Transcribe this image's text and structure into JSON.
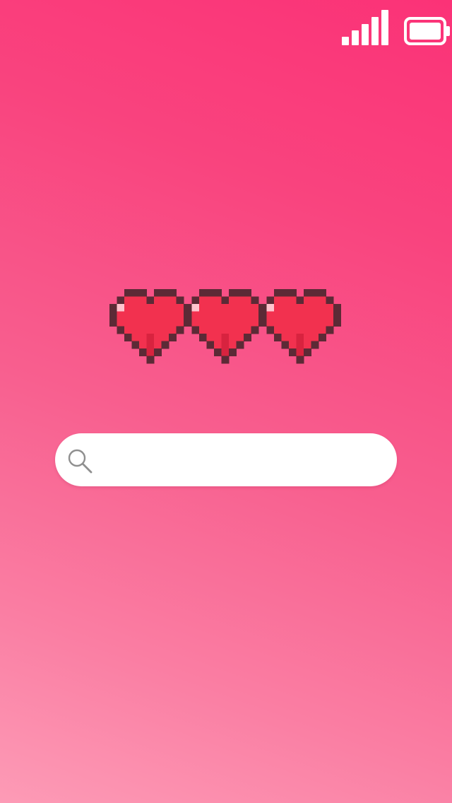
{
  "status_bar": {
    "signal_icon": "signal-strength-icon",
    "signal_bars": 5,
    "battery_icon": "battery-icon",
    "battery_level": 1.0
  },
  "hearts": {
    "icon": "pixel-heart-icon",
    "count": 3,
    "filled": 3
  },
  "search": {
    "icon": "search-icon",
    "value": "",
    "placeholder": ""
  },
  "colors": {
    "background_top": "#fb3277",
    "background_bottom": "#fd9bb6",
    "heart_fill": "#f2314f",
    "heart_outline": "#5c2a36",
    "search_bg": "#ffffff",
    "status_icons": "#ffffff"
  }
}
